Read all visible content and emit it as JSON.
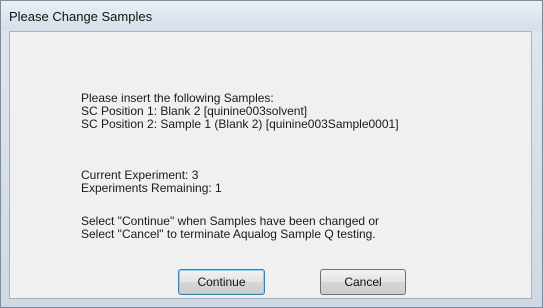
{
  "window": {
    "title": "Please Change Samples"
  },
  "message": {
    "intro": "Please insert the following Samples:",
    "position1": "SC Position 1: Blank 2 [quinine003solvent]",
    "position2": "SC Position 2: Sample 1 (Blank 2) [quinine003Sample0001]",
    "current_experiment": "Current Experiment: 3",
    "experiments_remaining": "Experiments Remaining: 1",
    "instruction_continue": "Select \"Continue\" when Samples have been changed  or",
    "instruction_cancel": "Select \"Cancel\" to terminate Aqualog Sample Q testing."
  },
  "buttons": {
    "continue_label": "Continue",
    "cancel_label": "Cancel"
  }
}
